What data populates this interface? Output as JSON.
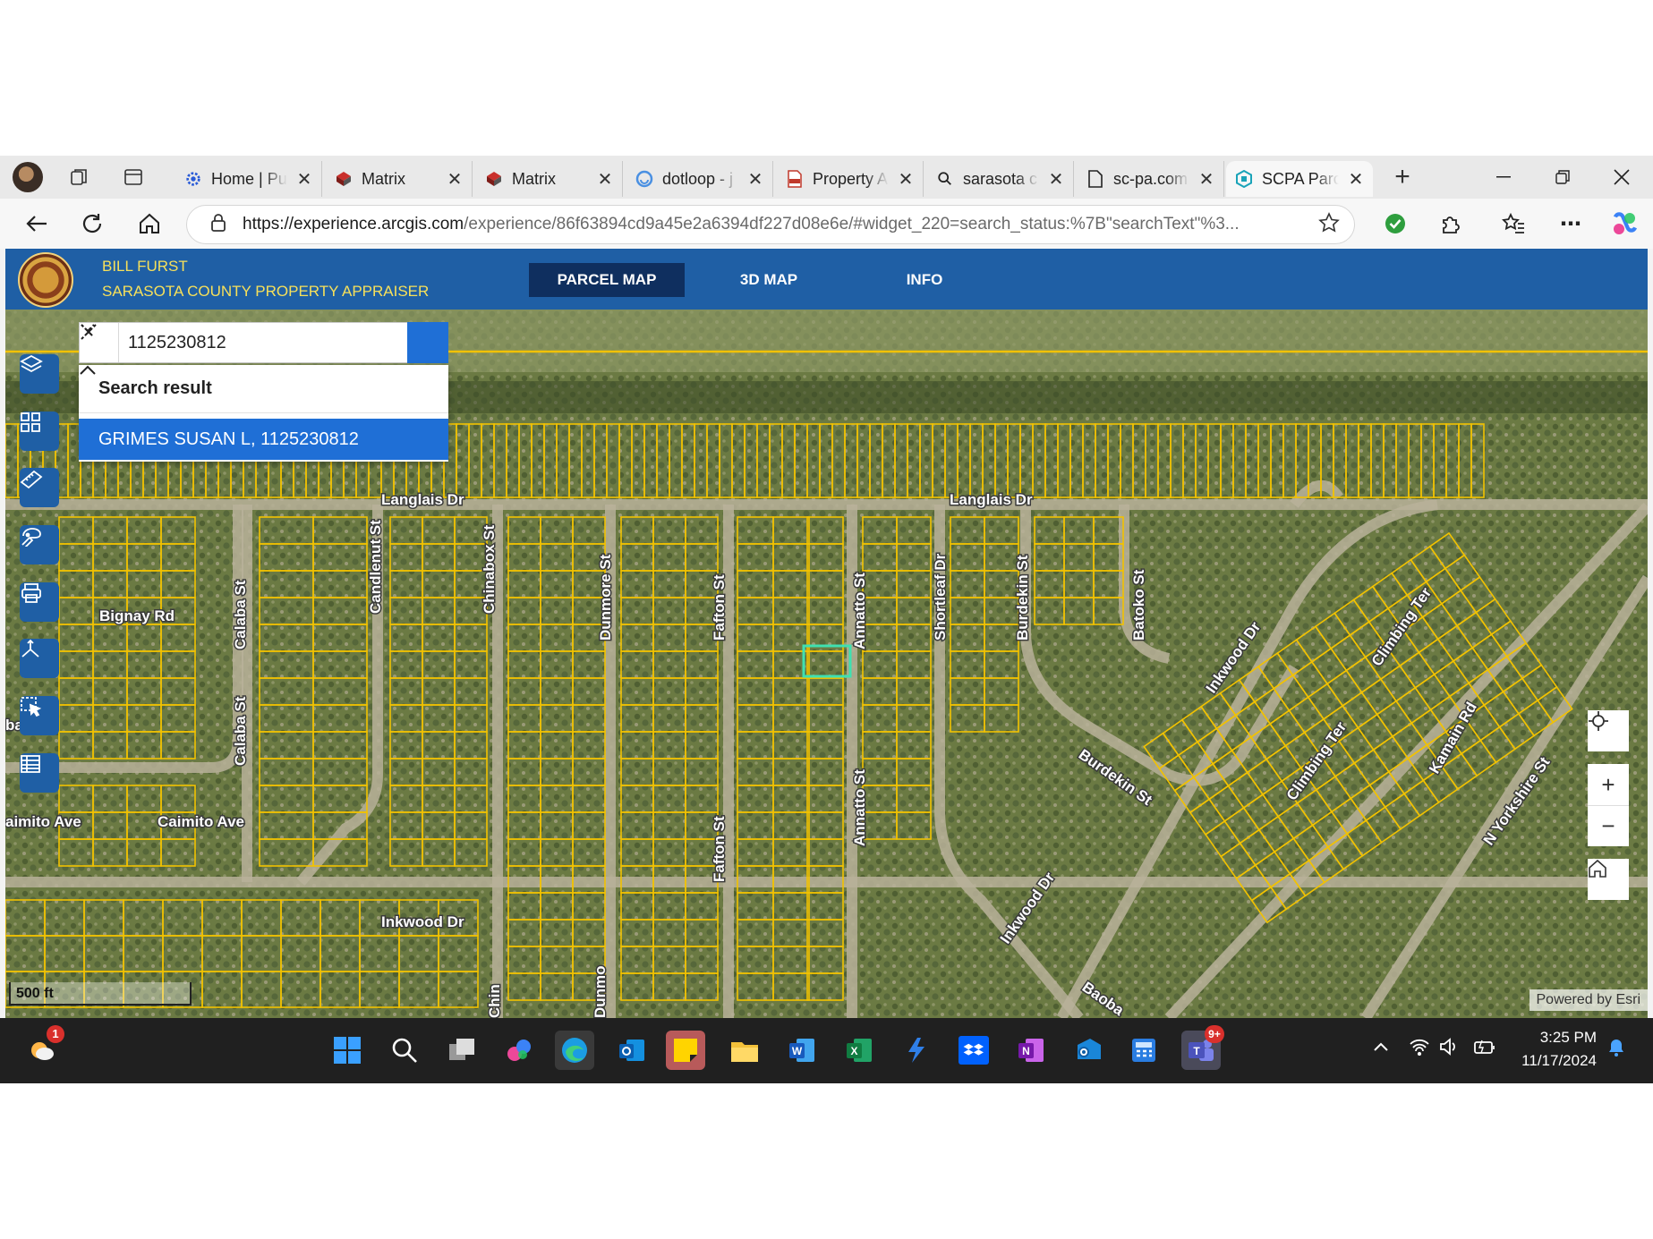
{
  "browser": {
    "tabs": [
      {
        "title": "Home | Pu",
        "icon": "gear-icon"
      },
      {
        "title": "Matrix",
        "icon": "matrix-logo-icon"
      },
      {
        "title": "Matrix",
        "icon": "matrix-logo-icon"
      },
      {
        "title": "dotloop - j",
        "icon": "dotloop-icon"
      },
      {
        "title": "Property A",
        "icon": "pdf-icon"
      },
      {
        "title": "sarasota c",
        "icon": "search-icon"
      },
      {
        "title": "sc-pa.com",
        "icon": "page-icon"
      },
      {
        "title": "SCPA Parc",
        "icon": "arcgis-icon",
        "active": true
      }
    ],
    "url_domain": "https://experience.arcgis.com",
    "url_path": "/experience/86f63894cd9a45e2a6394df227d08e6e/#widget_220=search_status:%7B\"searchText\"%3..."
  },
  "app": {
    "owner": "BILL FURST",
    "office": "SARASOTA COUNTY PROPERTY APPRAISER",
    "nav": [
      "PARCEL MAP",
      "3D MAP",
      "INFO"
    ],
    "active_nav": "PARCEL MAP",
    "accent": "#1f5fa5"
  },
  "search": {
    "value": "1125230812",
    "result_header": "Search result",
    "result_item": "GRIMES SUSAN L, 1125230812"
  },
  "map": {
    "street_labels": [
      "Langlais Dr",
      "Langlais Dr",
      "Bignay Rd",
      "Calaba St",
      "Calaba St",
      "Candlenut St",
      "Chinabox St",
      "Dunmore St",
      "Fafton St",
      "Fafton St",
      "Annatto St",
      "Annatto St",
      "Shortleaf Dr",
      "Burdekin St",
      "Batoko St",
      "Inkwood Dr",
      "Climbing Ter",
      "Climbing Ter",
      "Kamain Rd",
      "N Yorkshire St",
      "Burdekin St",
      "Inkwood Dr",
      "Inkwood Dr",
      "Caimito Ave",
      "aimito Ave",
      "ba Ave",
      "Dunmo",
      "Chin",
      "Baoba"
    ],
    "scale_label": "500 ft",
    "attribution": "Powered by Esri",
    "parcel_color": "#f2c200",
    "selected_color": "#3fe0b0"
  },
  "taskbar": {
    "notification_badge": "1",
    "teams_badge": "9+",
    "time": "3:25 PM",
    "date": "11/17/2024"
  }
}
